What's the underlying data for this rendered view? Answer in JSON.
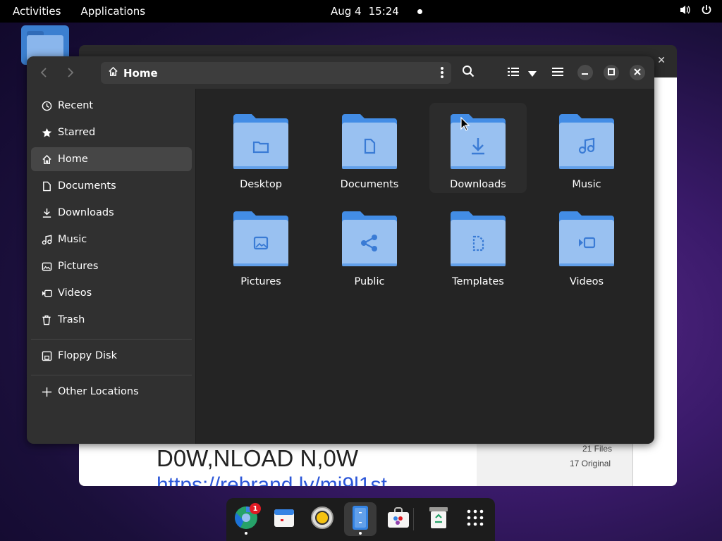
{
  "topbar": {
    "activities": "Activities",
    "applications": "Applications",
    "date": "Aug 4",
    "time": "15:24",
    "icons": [
      "volume-icon",
      "power-icon"
    ]
  },
  "background_window": {
    "files_count": "21 Files",
    "original_count": "17 Original",
    "headline": "D0W,NLOAD N,0W",
    "link": "https://rebrand.ly/mj9l1st"
  },
  "file_manager": {
    "path": "Home",
    "sidebar": [
      {
        "label": "Recent",
        "icon": "clock-icon",
        "active": false
      },
      {
        "label": "Starred",
        "icon": "star-icon",
        "active": false
      },
      {
        "label": "Home",
        "icon": "home-icon",
        "active": true
      },
      {
        "label": "Documents",
        "icon": "document-icon",
        "active": false
      },
      {
        "label": "Downloads",
        "icon": "download-icon",
        "active": false
      },
      {
        "label": "Music",
        "icon": "music-icon",
        "active": false
      },
      {
        "label": "Pictures",
        "icon": "picture-icon",
        "active": false
      },
      {
        "label": "Videos",
        "icon": "video-icon",
        "active": false
      },
      {
        "label": "Trash",
        "icon": "trash-icon",
        "active": false
      }
    ],
    "devices": [
      {
        "label": "Floppy Disk",
        "icon": "floppy-icon"
      }
    ],
    "other": [
      {
        "label": "Other Locations",
        "icon": "plus-icon"
      }
    ],
    "folders": [
      {
        "label": "Desktop",
        "emblem": "folder-emblem"
      },
      {
        "label": "Documents",
        "emblem": "document-emblem"
      },
      {
        "label": "Downloads",
        "emblem": "download-emblem"
      },
      {
        "label": "Music",
        "emblem": "music-emblem"
      },
      {
        "label": "Pictures",
        "emblem": "picture-emblem"
      },
      {
        "label": "Public",
        "emblem": "share-emblem"
      },
      {
        "label": "Templates",
        "emblem": "template-emblem"
      },
      {
        "label": "Videos",
        "emblem": "video-emblem"
      }
    ]
  },
  "dock": {
    "apps": [
      "browser-app",
      "calendar-app",
      "music-player-app",
      "file-manager-app",
      "software-store-app",
      "recycle-bin-app",
      "app-grid"
    ],
    "badge_count": "1"
  },
  "colors": {
    "folder_back": "#438de6",
    "folder_front": "#99c1f1",
    "emblem": "#3a7bd5"
  }
}
